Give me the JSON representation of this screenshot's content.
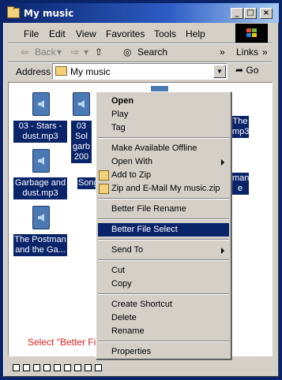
{
  "window": {
    "title": "My music"
  },
  "titlebar": {
    "minimize": "_",
    "maximize": "□",
    "close": "×"
  },
  "menubar": [
    "File",
    "Edit",
    "View",
    "Favorites",
    "Tools",
    "Help"
  ],
  "toolbar": {
    "back": "Back",
    "search": "Search",
    "links": "Links",
    "chevron": "»"
  },
  "address": {
    "label": "Address",
    "value": "My music",
    "go": "Go"
  },
  "files": [
    {
      "label_lines": [
        "03 - Stars -",
        "dust.mp3"
      ]
    },
    {
      "label_lines": [
        "03",
        "Sol",
        "garb",
        "200"
      ]
    },
    {
      "label_lines": [
        "Garbage and",
        "dust.mp3"
      ]
    },
    {
      "label_lines": [
        "Song"
      ]
    },
    {
      "label_lines": [
        "The Postman",
        "and the Ga..."
      ]
    },
    {
      "label_lines": [
        "The",
        "mp3"
      ]
    },
    {
      "label_lines": [
        "man",
        "e"
      ]
    }
  ],
  "context_menu": {
    "items": [
      {
        "label": "Open",
        "bold": true
      },
      {
        "label": "Play"
      },
      {
        "label": "Tag"
      },
      {
        "sep": true
      },
      {
        "label": "Make Available Offline"
      },
      {
        "label": "Open With",
        "submenu": true
      },
      {
        "label": "Add to Zip",
        "icon": "winzip-icon"
      },
      {
        "label": "Zip and E-Mail My music.zip",
        "icon": "winzip-icon"
      },
      {
        "sep": true
      },
      {
        "label": "Better File Rename"
      },
      {
        "sep": true
      },
      {
        "label": "Better File Select",
        "selected": true
      },
      {
        "sep": true
      },
      {
        "label": "Send To",
        "submenu": true
      },
      {
        "sep": true
      },
      {
        "label": "Cut"
      },
      {
        "label": "Copy"
      },
      {
        "sep": true
      },
      {
        "label": "Create Shortcut"
      },
      {
        "label": "Delete"
      },
      {
        "label": "Rename"
      },
      {
        "sep": true
      },
      {
        "label": "Properties"
      }
    ]
  },
  "caption": "Select \"Better File Select\"...",
  "colors": {
    "selection": "#0a246a",
    "face": "#d4d0c8",
    "caption": "#e02020"
  }
}
